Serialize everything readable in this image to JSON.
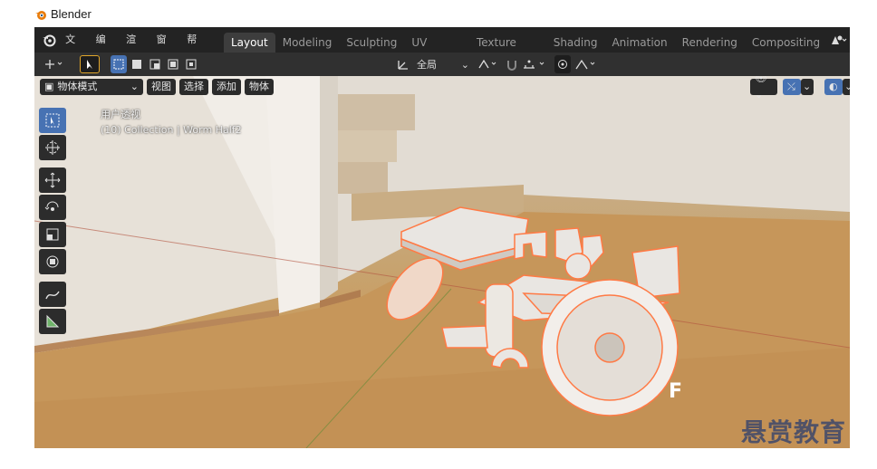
{
  "titlebar": {
    "title": "Blender"
  },
  "menubar": {
    "menus": [
      "文件",
      "编辑",
      "渲染",
      "窗口",
      "帮助"
    ],
    "workspaces": [
      "Layout",
      "Modeling",
      "Sculpting",
      "UV Editing",
      "Texture Paint",
      "Shading",
      "Animation",
      "Rendering",
      "Compositing"
    ],
    "active_workspace": "Layout"
  },
  "toolbar": {
    "orientation": "全局"
  },
  "viewport_header": {
    "mode": "物体模式",
    "menus": [
      "视图",
      "选择",
      "添加",
      "物体"
    ]
  },
  "viewport": {
    "view_name": "用户透视",
    "collection_info": "(10) Collection | Worm Half2",
    "key_indicator": "F"
  },
  "watermark": "悬赏教育",
  "colors": {
    "accent": "#4772b3",
    "selection_outline": "#ff7a45",
    "header_bg": "#232323"
  },
  "icons": [
    "blender-logo-icon",
    "select-box-icon",
    "cursor-icon",
    "move-icon",
    "rotate-icon",
    "scale-icon",
    "transform-icon",
    "annotate-icon",
    "measure-icon",
    "gizmo-icon",
    "overlay-icon",
    "shading-icon",
    "snap-icon",
    "proportional-icon"
  ]
}
